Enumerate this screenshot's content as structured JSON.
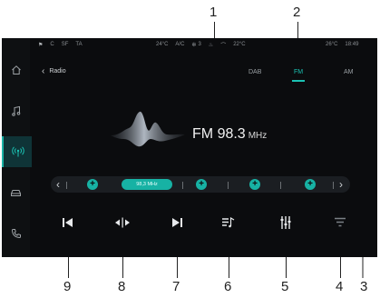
{
  "status_bar": {
    "left": [
      "C",
      "SF",
      "TA"
    ],
    "center": [
      "24°C",
      "A/C",
      "3",
      "22°C"
    ],
    "right": [
      "26°C",
      "18:49"
    ]
  },
  "header": {
    "back_label": "Radio"
  },
  "tabs": [
    {
      "label": "DAB",
      "active": false
    },
    {
      "label": "FM",
      "active": true
    },
    {
      "label": "AM",
      "active": false
    }
  ],
  "station": {
    "band": "FM",
    "frequency": "98.3",
    "unit": "MHz"
  },
  "tuner": {
    "selected_label": "98,3 MHz",
    "preset_symbol": "+"
  },
  "sidebar": {
    "items": [
      {
        "icon": "home-icon",
        "active": false
      },
      {
        "icon": "music-note-icon",
        "active": false
      },
      {
        "icon": "radio-icon",
        "active": true
      },
      {
        "icon": "car-icon",
        "active": false
      },
      {
        "icon": "phone-icon",
        "active": false
      }
    ]
  },
  "controls": [
    {
      "icon": "seek-back-icon"
    },
    {
      "icon": "scan-icon"
    },
    {
      "icon": "seek-forward-icon"
    },
    {
      "icon": "station-list-icon"
    },
    {
      "icon": "equalizer-icon"
    },
    {
      "icon": "filter-icon"
    }
  ],
  "callouts": [
    "1",
    "2",
    "3",
    "4",
    "5",
    "6",
    "7",
    "8",
    "9"
  ],
  "colors": {
    "accent": "#1bc2b3",
    "background": "#0b0c0e",
    "sidebar_active": "#0f3437"
  }
}
